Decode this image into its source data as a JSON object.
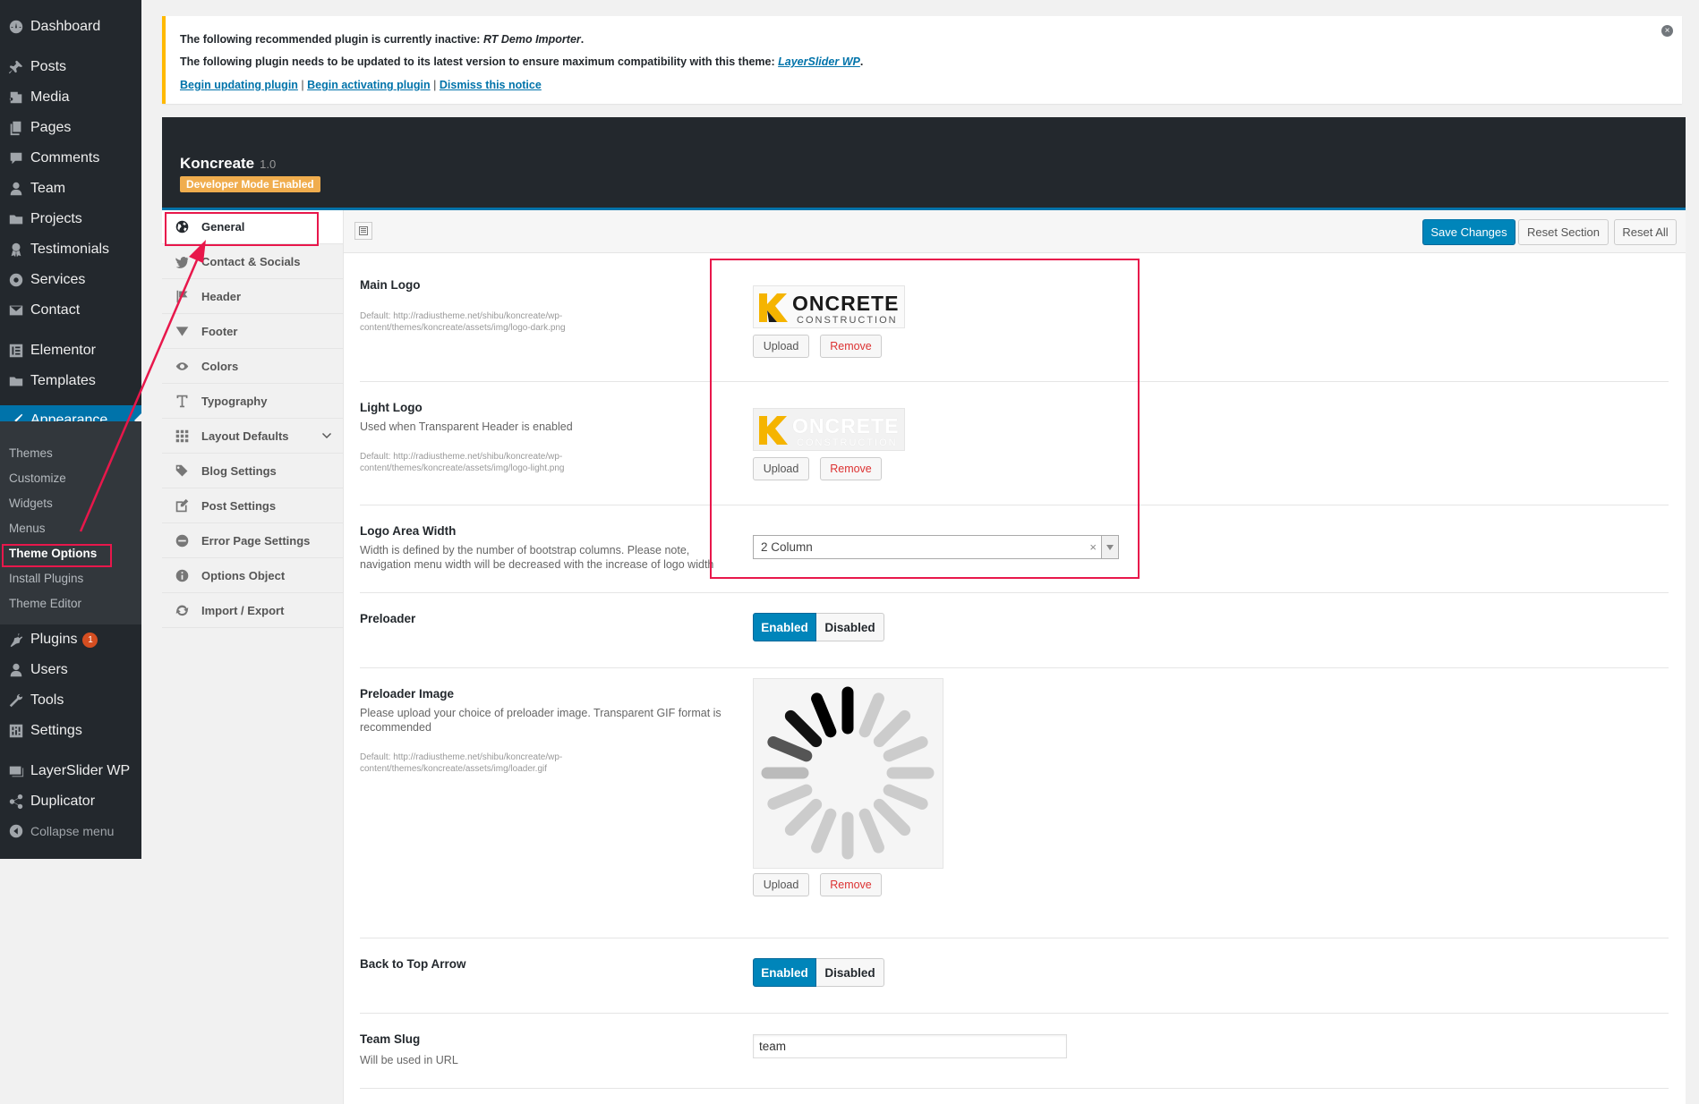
{
  "admin_menu": {
    "items": [
      {
        "label": "Dashboard",
        "icon": "dashboard-icon"
      },
      {
        "label": "Posts",
        "icon": "pin-icon"
      },
      {
        "label": "Media",
        "icon": "media-icon"
      },
      {
        "label": "Pages",
        "icon": "pages-icon"
      },
      {
        "label": "Comments",
        "icon": "comments-icon"
      },
      {
        "label": "Team",
        "icon": "user-icon"
      },
      {
        "label": "Projects",
        "icon": "folder-icon"
      },
      {
        "label": "Testimonials",
        "icon": "award-icon"
      },
      {
        "label": "Services",
        "icon": "lifebuoy-icon"
      },
      {
        "label": "Contact",
        "icon": "mail-icon"
      },
      {
        "label": "Elementor",
        "icon": "elementor-icon"
      },
      {
        "label": "Templates",
        "icon": "folder-icon"
      },
      {
        "label": "Appearance",
        "icon": "brush-icon"
      },
      {
        "label": "Plugins",
        "icon": "plug-icon",
        "badge": "1"
      },
      {
        "label": "Users",
        "icon": "user-icon"
      },
      {
        "label": "Tools",
        "icon": "wrench-icon"
      },
      {
        "label": "Settings",
        "icon": "sliders-icon"
      },
      {
        "label": "LayerSlider WP",
        "icon": "layers-icon"
      },
      {
        "label": "Duplicator",
        "icon": "share-icon"
      },
      {
        "label": "Collapse menu",
        "icon": "collapse-icon"
      }
    ],
    "appearance_submenu": [
      "Themes",
      "Customize",
      "Widgets",
      "Menus",
      "Theme Options",
      "Install Plugins",
      "Theme Editor"
    ]
  },
  "notice": {
    "line1_prefix": "The following recommended plugin is currently inactive: ",
    "line1_plugin": "RT Demo Importer",
    "line1_suffix": ".",
    "line2_prefix": "The following plugin needs to be updated to its latest version to ensure maximum compatibility with this theme: ",
    "line2_plugin": "LayerSlider WP",
    "line2_suffix": ".",
    "link_update": "Begin updating plugin",
    "link_activate": "Begin activating plugin",
    "link_dismiss": "Dismiss this notice",
    "separator": "|"
  },
  "panel": {
    "title": "Koncreate",
    "version": "1.0",
    "dev_badge": "Developer Mode Enabled"
  },
  "toolbar": {
    "save": "Save Changes",
    "reset_section": "Reset Section",
    "reset_all": "Reset All"
  },
  "sections": [
    {
      "label": "General",
      "icon": "globe-icon"
    },
    {
      "label": "Contact & Socials",
      "icon": "twitter-icon"
    },
    {
      "label": "Header",
      "icon": "flag-icon"
    },
    {
      "label": "Footer",
      "icon": "triangle-down-icon"
    },
    {
      "label": "Colors",
      "icon": "eye-icon"
    },
    {
      "label": "Typography",
      "icon": "text-icon"
    },
    {
      "label": "Layout Defaults",
      "icon": "grid-icon"
    },
    {
      "label": "Blog Settings",
      "icon": "tags-icon"
    },
    {
      "label": "Post Settings",
      "icon": "edit-icon"
    },
    {
      "label": "Error Page Settings",
      "icon": "minus-circle-icon"
    },
    {
      "label": "Options Object",
      "icon": "info-icon"
    },
    {
      "label": "Import / Export",
      "icon": "refresh-icon"
    }
  ],
  "fields": {
    "main_logo": {
      "title": "Main Logo",
      "desc": "Default: http://radiustheme.net/shibu/koncreate/wp-content/themes/koncreate/assets/img/logo-dark.png",
      "logo_text": "ONCRETE",
      "logo_sub": "CONSTRUCTION",
      "upload": "Upload",
      "remove": "Remove"
    },
    "light_logo": {
      "title": "Light Logo",
      "subtitle": "Used when Transparent Header is enabled",
      "desc": "Default: http://radiustheme.net/shibu/koncreate/wp-content/themes/koncreate/assets/img/logo-light.png",
      "logo_text": "ONCRETE",
      "logo_sub": "CONSTRUCTION",
      "upload": "Upload",
      "remove": "Remove"
    },
    "logo_width": {
      "title": "Logo Area Width",
      "subtitle": "Width is defined by the number of bootstrap columns. Please note, navigation menu width will be decreased with the increase of logo width",
      "value": "2 Column",
      "clear": "×"
    },
    "preloader": {
      "title": "Preloader",
      "on": "Enabled",
      "off": "Disabled"
    },
    "preloader_image": {
      "title": "Preloader Image",
      "subtitle": "Please upload your choice of preloader image. Transparent GIF format is recommended",
      "desc": "Default: http://radiustheme.net/shibu/koncreate/wp-content/themes/koncreate/assets/img/loader.gif",
      "upload": "Upload",
      "remove": "Remove"
    },
    "back_to_top": {
      "title": "Back to Top Arrow",
      "on": "Enabled",
      "off": "Disabled"
    },
    "team_slug": {
      "title": "Team Slug",
      "subtitle": "Will be used in URL",
      "value": "team"
    }
  },
  "colors": {
    "accent": "#0073aa",
    "notice_border": "#ffb900",
    "annotation": "#e8174b",
    "dev_badge": "#f0ad4e",
    "logo_yellow": "#f5b400"
  }
}
